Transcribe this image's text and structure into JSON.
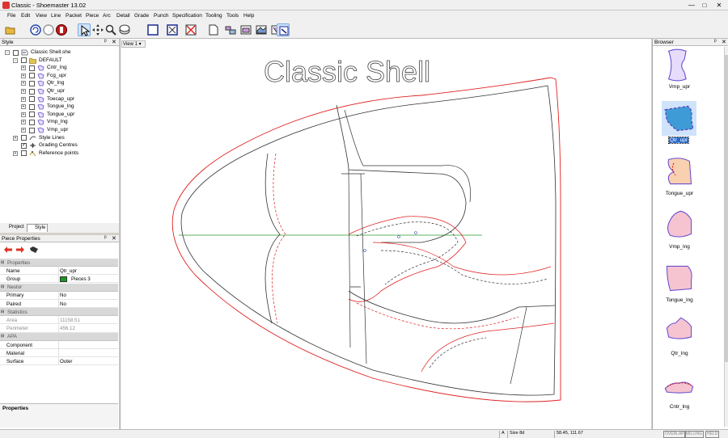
{
  "window": {
    "title": "Classic - Shoemaster 13.02",
    "min": "—",
    "max": "□",
    "close": "✕"
  },
  "menu": [
    "File",
    "Edit",
    "View",
    "Line",
    "Packet",
    "Piece",
    "Arc",
    "Detail",
    "Grade",
    "Punch",
    "Specification",
    "Tooling",
    "Tools",
    "Help"
  ],
  "style_panel": {
    "title": "Style",
    "tree": [
      {
        "label": "Classic Shell.she",
        "level": 0,
        "exp": "-",
        "icon": "style-file-icon"
      },
      {
        "label": "DEFAULT",
        "level": 1,
        "exp": "-",
        "icon": "folder-icon"
      },
      {
        "label": "Cntr_lng",
        "level": 2,
        "exp": "+",
        "icon": "piece-icon"
      },
      {
        "label": "Fcg_upr",
        "level": 2,
        "exp": "+",
        "icon": "piece-icon"
      },
      {
        "label": "Qtr_lng",
        "level": 2,
        "exp": "+",
        "icon": "piece-icon"
      },
      {
        "label": "Qtr_upr",
        "level": 2,
        "exp": "+",
        "icon": "piece-icon"
      },
      {
        "label": "Toecap_upr",
        "level": 2,
        "exp": "+",
        "icon": "piece-icon"
      },
      {
        "label": "Tongue_lng",
        "level": 2,
        "exp": "+",
        "icon": "piece-icon"
      },
      {
        "label": "Tongue_upr",
        "level": 2,
        "exp": "+",
        "icon": "piece-icon"
      },
      {
        "label": "Vmp_lng",
        "level": 2,
        "exp": "+",
        "icon": "piece-icon"
      },
      {
        "label": "Vmp_upr",
        "level": 2,
        "exp": "+",
        "icon": "piece-icon"
      },
      {
        "label": "Style Lines",
        "level": 1,
        "exp": "+",
        "icon": "style-lines-icon"
      },
      {
        "label": "Grading Centres",
        "level": 1,
        "exp": "",
        "icon": "grading-centre-icon",
        "checked": true
      },
      {
        "label": "Reference points",
        "level": 1,
        "exp": "+",
        "icon": "reference-points-icon"
      }
    ],
    "tabs": [
      "Project",
      "Style"
    ]
  },
  "piece_properties": {
    "title": "Piece Properties",
    "rows": [
      {
        "type": "section",
        "key": "Properties"
      },
      {
        "key": "Name",
        "value": "Qtr_upr"
      },
      {
        "key": "Group",
        "value": "Pieces 3",
        "swatch": "#1a9a1a"
      },
      {
        "type": "section",
        "key": "Nestor"
      },
      {
        "key": "Primary",
        "value": "No"
      },
      {
        "key": "Paired",
        "value": "No"
      },
      {
        "type": "section",
        "key": "Statistics"
      },
      {
        "key": "Area",
        "value": "11158.51",
        "grey": true
      },
      {
        "key": "Perimeter",
        "value": "456.12",
        "grey": true
      },
      {
        "type": "section",
        "key": "APA"
      },
      {
        "key": "Component",
        "value": ""
      },
      {
        "key": "Material",
        "value": ""
      },
      {
        "key": "Surface",
        "value": "Outer"
      }
    ],
    "footer": "Properties"
  },
  "canvas": {
    "view_label": "View 1",
    "style_title": "Classic Shell"
  },
  "browser": {
    "title": "Browser",
    "items": [
      {
        "label": "Vmp_upr",
        "selected": false
      },
      {
        "label": "Qtr_upr",
        "selected": true
      },
      {
        "label": "Tongue_upr",
        "selected": false
      },
      {
        "label": "Vmp_lng",
        "selected": false
      },
      {
        "label": "Tongue_lng",
        "selected": false
      },
      {
        "label": "Qtr_lng",
        "selected": false
      },
      {
        "label": "Cntr_lng",
        "selected": false
      }
    ]
  },
  "status": {
    "mode": "A",
    "size": "Size 8d",
    "coords": "58.45, 111.67",
    "overlap": "OVERLAP",
    "milling": "MILLING",
    "held": "HELD"
  },
  "colors": {
    "accent": "#2a6bcc",
    "pattern_red": "#e02020",
    "pattern_dark": "#333333",
    "piece_fill": "#f6c4d0",
    "piece_outline": "#6a4fd0",
    "grading_line": "#2a9a2a"
  }
}
